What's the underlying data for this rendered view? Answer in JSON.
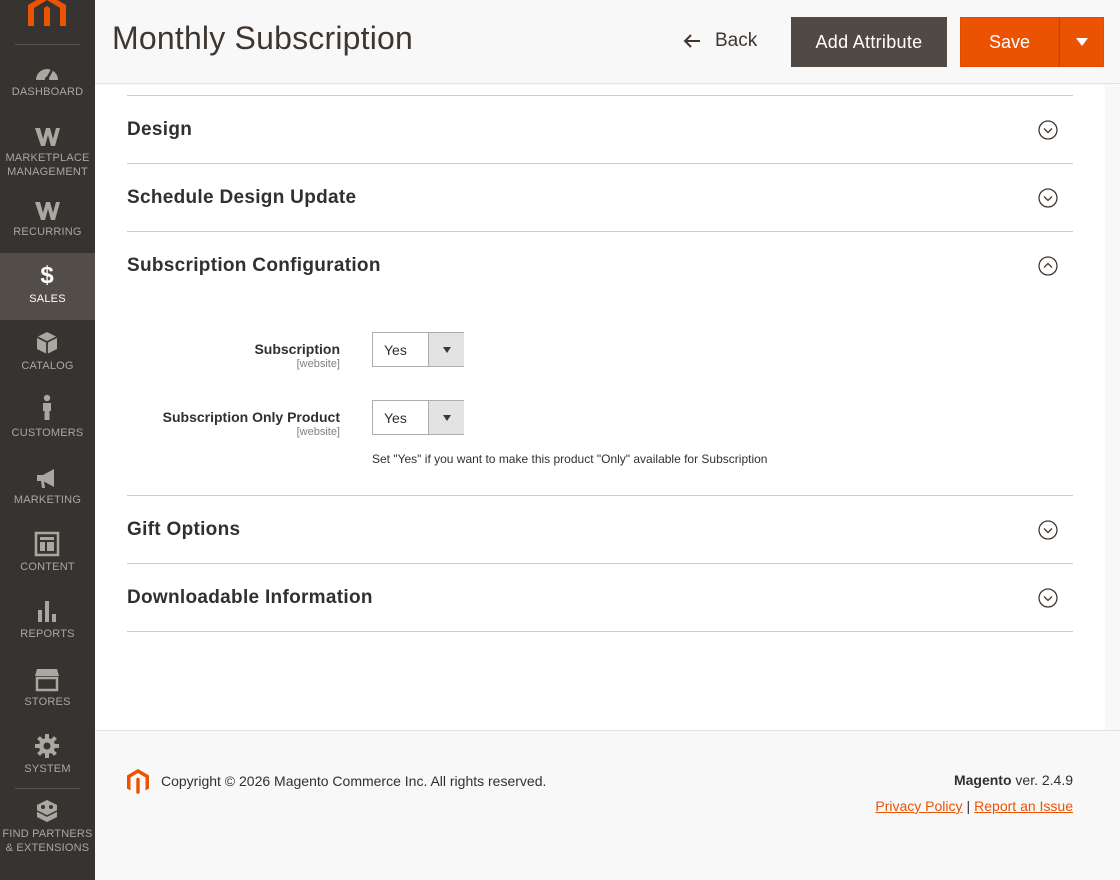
{
  "sidebar": {
    "items": [
      {
        "label": "DASHBOARD",
        "icon": "dashboard-icon"
      },
      {
        "label": "MARKETPLACE MANAGEMENT",
        "icon": "marketplace-w-icon"
      },
      {
        "label": "RECURRING",
        "icon": "recurring-w-icon"
      },
      {
        "label": "SALES",
        "icon": "dollar-icon",
        "active": true
      },
      {
        "label": "CATALOG",
        "icon": "cube-icon"
      },
      {
        "label": "CUSTOMERS",
        "icon": "person-icon"
      },
      {
        "label": "MARKETING",
        "icon": "megaphone-icon"
      },
      {
        "label": "CONTENT",
        "icon": "layout-icon"
      },
      {
        "label": "REPORTS",
        "icon": "bar-chart-icon"
      },
      {
        "label": "STORES",
        "icon": "storefront-icon"
      },
      {
        "label": "SYSTEM",
        "icon": "gear-icon"
      },
      {
        "label": "FIND PARTNERS & EXTENSIONS",
        "icon": "blocks-icon"
      }
    ]
  },
  "header": {
    "title": "Monthly Subscription",
    "back_label": "Back",
    "add_attribute_label": "Add Attribute",
    "save_label": "Save"
  },
  "sections": {
    "design": "Design",
    "schedule": "Schedule Design Update",
    "subscription": "Subscription Configuration",
    "gift": "Gift Options",
    "downloadable": "Downloadable Information"
  },
  "fields": {
    "subscription": {
      "label": "Subscription",
      "scope": "[website]",
      "value": "Yes"
    },
    "subscription_only": {
      "label": "Subscription Only Product",
      "scope": "[website]",
      "value": "Yes",
      "note": "Set \"Yes\" if you want to make this product \"Only\" available for Subscription"
    }
  },
  "footer": {
    "copyright": "Copyright © 2026 Magento Commerce Inc. All rights reserved.",
    "brand": "Magento",
    "version": "ver. 2.4.9",
    "privacy": "Privacy Policy",
    "separator": "|",
    "report": "Report an Issue"
  },
  "colors": {
    "sidebar": "#373330",
    "accent": "#eb5202",
    "dark_button": "#514943"
  }
}
